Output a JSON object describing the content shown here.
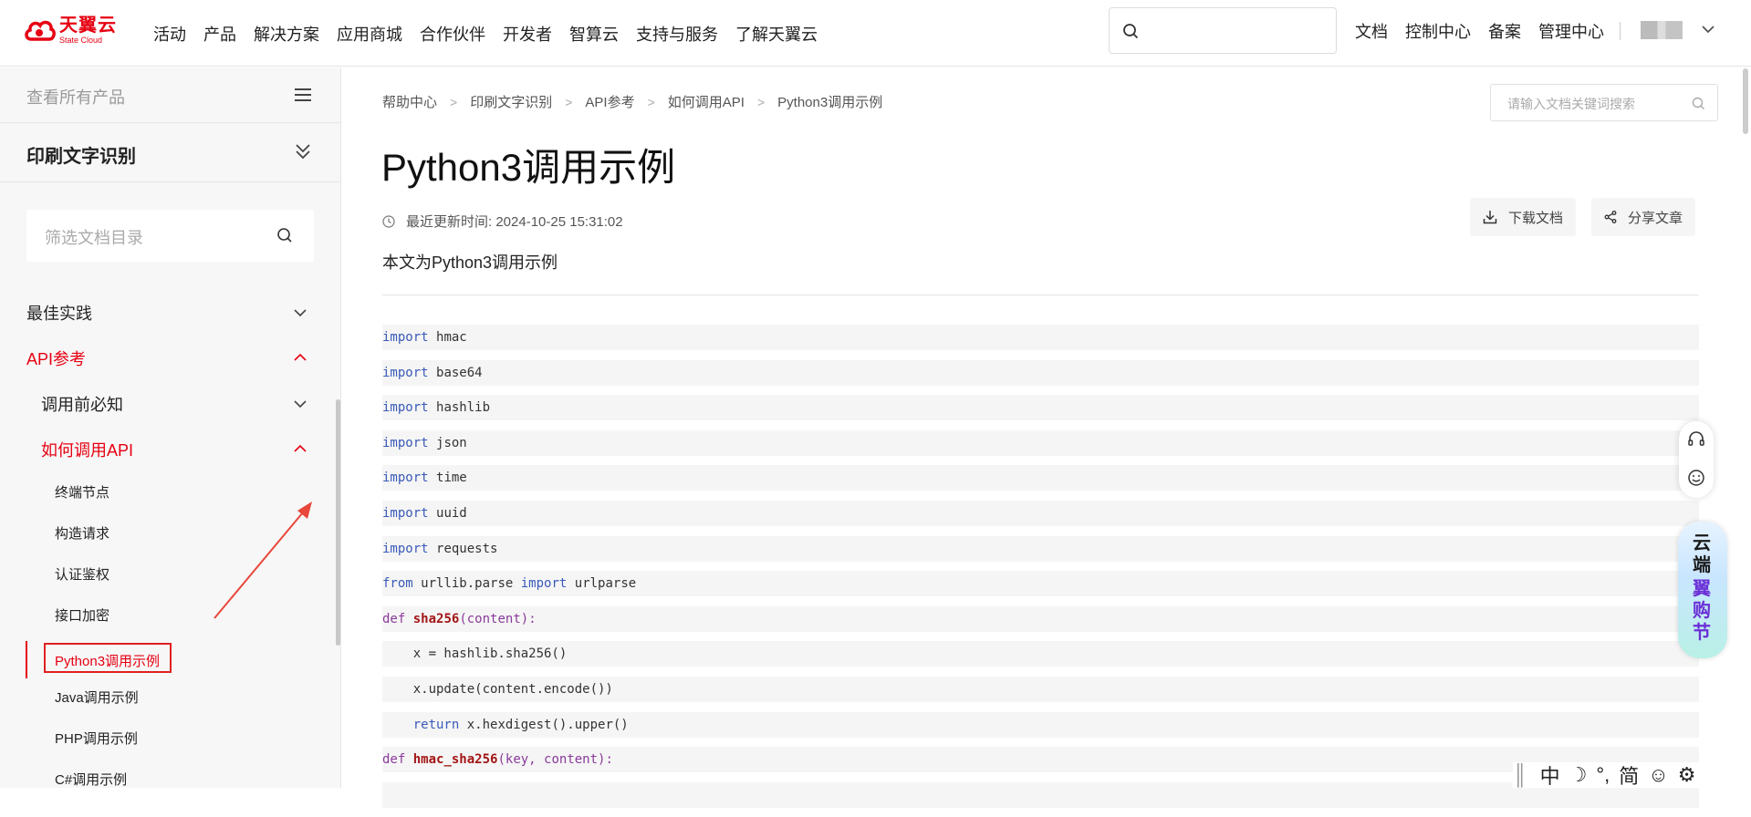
{
  "brand": {
    "name_cn": "天翼云",
    "name_en": "State Cloud",
    "color": "#e60012"
  },
  "main_nav": [
    "活动",
    "产品",
    "解决方案",
    "应用商城",
    "合作伙伴",
    "开发者",
    "智算云",
    "支持与服务",
    "了解天翼云"
  ],
  "top_links": [
    "文档",
    "控制中心",
    "备案",
    "管理中心"
  ],
  "sidebar": {
    "all_products": "查看所有产品",
    "product_name": "印刷文字识别",
    "filter_placeholder": "筛选文档目录",
    "sections": [
      {
        "label": "最佳实践",
        "expanded": false
      },
      {
        "label": "API参考",
        "expanded": true
      },
      {
        "label": "调用前必知",
        "expanded": false
      },
      {
        "label": "如何调用API",
        "expanded": true
      }
    ],
    "items": [
      "终端节点",
      "构造请求",
      "认证鉴权",
      "接口加密",
      "Python3调用示例",
      "Java调用示例",
      "PHP调用示例",
      "C#调用示例"
    ],
    "active_item": "Python3调用示例"
  },
  "breadcrumb": [
    "帮助中心",
    "印刷文字识别",
    "API参考",
    "如何调用API",
    "Python3调用示例"
  ],
  "doc_search_placeholder": "请输入文档关键词搜索",
  "article": {
    "title": "Python3调用示例",
    "updated": "最近更新时间: 2024-10-25 15:31:02",
    "download_label": "下载文档",
    "share_label": "分享文章",
    "intro": "本文为Python3调用示例"
  },
  "code": {
    "import_kw": "import",
    "from_kw": "from",
    "def_kw": "def",
    "return_kw": "return",
    "modules": [
      "hmac",
      "base64",
      "hashlib",
      "json",
      "time",
      "uuid",
      "requests"
    ],
    "from_module": "urllib.parse",
    "from_name": "urlparse",
    "fn1_name": "sha256",
    "fn1_param": "content",
    "line_x_assign": "    x = hashlib.sha256()",
    "line_x_update": "    x.update(content.encode())",
    "line_return_expr": " x.hexdigest().upper()",
    "fn2_name": "hmac_sha256",
    "fn2_params": "key, content"
  },
  "promo_text": [
    "云",
    "端",
    "翼",
    "购",
    "节"
  ],
  "ime_items": [
    "中",
    "☽",
    "°,",
    "简",
    "☺",
    "⚙"
  ]
}
